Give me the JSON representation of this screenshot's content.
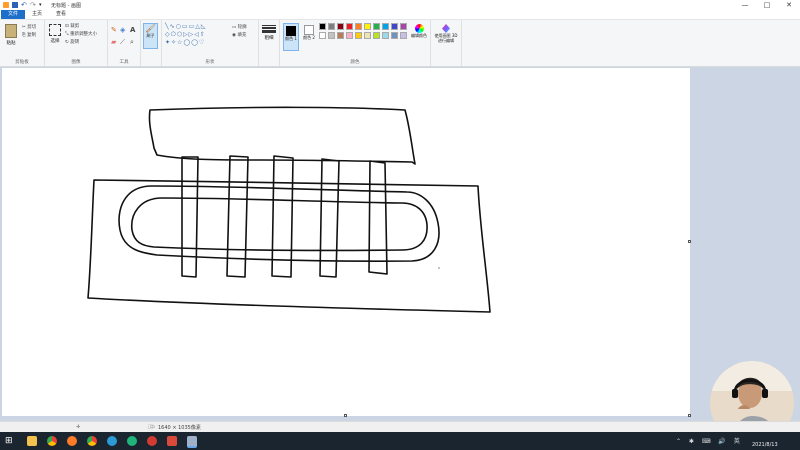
{
  "window": {
    "title": "无标题 - 画图",
    "minimize_glyph": "—",
    "maximize_glyph": "□",
    "close_glyph": "✕"
  },
  "tabs": {
    "file": "文件",
    "home": "主页",
    "view": "查看"
  },
  "ribbon": {
    "clipboard": {
      "label": "剪贴板",
      "paste": "粘贴",
      "cut": "剪切",
      "copy": "复制"
    },
    "image": {
      "label": "图像",
      "select": "选择",
      "crop": "裁剪",
      "resize": "重新调整大小",
      "rotate": "旋转"
    },
    "tools": {
      "label": "工具",
      "pencil": "铅笔",
      "fill": "填充",
      "text": "A",
      "eraser": "橡皮擦",
      "picker": "颜色选取器",
      "magnifier": "放大镜"
    },
    "brushes": {
      "label": "刷子"
    },
    "shapes": {
      "label": "形状",
      "outline": "轮廓",
      "fill": "填充"
    },
    "size": {
      "label": "粗细"
    },
    "colors": {
      "label": "颜色",
      "color1": "颜色 1",
      "color2": "颜色 2",
      "edit": "编辑颜色",
      "palette_row1": [
        "#000000",
        "#7f7f7f",
        "#880015",
        "#ed1c24",
        "#ff7f27",
        "#fff200",
        "#22b14c",
        "#00a2e8",
        "#3f48cc",
        "#a349a4"
      ],
      "palette_row2": [
        "#ffffff",
        "#c3c3c3",
        "#b97a57",
        "#ffaec9",
        "#ffc90e",
        "#efe4b0",
        "#b5e61d",
        "#99d9ea",
        "#7092be",
        "#c8bfe7"
      ]
    },
    "paint3d": {
      "label": "使用画图 3D 进行编辑"
    }
  },
  "status": {
    "cursor": "",
    "selection": "",
    "canvas_size": "1640 × 1035像素",
    "filesize": ""
  },
  "taskbar": {
    "clock_time": "",
    "clock_date": "2021/8/13"
  },
  "colors": {
    "accent": "#1e6fc9",
    "canvas_bg": "#cbd5e3",
    "taskbar_bg": "#1b2530"
  }
}
